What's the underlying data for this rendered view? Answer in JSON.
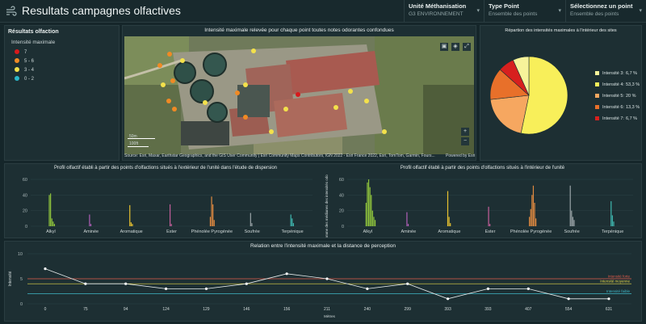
{
  "app": {
    "title": "Resultats campagnes olfactives",
    "icon": "wind-icon"
  },
  "header_selectors": [
    {
      "label": "Unité Méthanisation",
      "value": "G3 ENVIRONNEMENT"
    },
    {
      "label": "Type Point",
      "value": "Ensemble des points"
    },
    {
      "label": "Sélectionnez un point",
      "value": "Ensemble des points"
    }
  ],
  "legend": {
    "title": "Résultats olfaction",
    "subtitle": "Intensité maximale",
    "items": [
      {
        "label": "7",
        "color": "#d7191c"
      },
      {
        "label": "5 - 6",
        "color": "#f08a24"
      },
      {
        "label": "3 - 4",
        "color": "#f3e14b"
      },
      {
        "label": "0 - 2",
        "color": "#2ab7c9"
      }
    ]
  },
  "map": {
    "title": "Intensité maximale relevée pour chaque point toutes notes odorantes confondues",
    "scale_top": "50m",
    "scale_bottom": "100ft",
    "attribution": "Source: Esri, Maxar, Earthstar Geographics, and the GIS User Community | Esri Community Maps Contributors, IGN 2022 - Esri France 2022, Esri, TomTom, Garmin, Fours...",
    "powered_by": "Powered by Esri",
    "controls": [
      "bookmark-icon",
      "layers-icon",
      "expand-icon"
    ],
    "zoom_in": "+",
    "zoom_out": "−"
  },
  "chart_data": [
    {
      "type": "pie",
      "title": "Répartion des intensités maximales à l'intérieur des sites",
      "slices": [
        {
          "label": "Intensité 3:",
          "value": 6.7,
          "pct_text": "6,7 %",
          "color": "#f6f39a"
        },
        {
          "label": "Intensité 4:",
          "value": 53.3,
          "pct_text": "53,3 %",
          "color": "#f8ef5a"
        },
        {
          "label": "Intensité 5:",
          "value": 20,
          "pct_text": "20 %",
          "color": "#f6a760"
        },
        {
          "label": "Intensité 6:",
          "value": 13.3,
          "pct_text": "13,3 %",
          "color": "#e8702a"
        },
        {
          "label": "Intensité 7:",
          "value": 6.7,
          "pct_text": "6,7 %",
          "color": "#d7201e"
        }
      ]
    },
    {
      "type": "bar",
      "title": "Profil olfactif établi à partir des points d'olfactions situés à l'extérieur de l'unité dans l'étude de dispersion",
      "ylabel": "",
      "ylim": [
        0,
        60
      ],
      "yticks": [
        0,
        20,
        40,
        60
      ],
      "categories": [
        "Alkyl",
        "Aminée",
        "Aromatique",
        "Ester",
        "Phénolée Pyrogénée",
        "Soufrée",
        "Terpénique"
      ],
      "colors": [
        "#8fc43c",
        "#b05fb8",
        "#e8c230",
        "#c45f9a",
        "#e08a40",
        "#9aa4a8",
        "#3fb8b0"
      ],
      "values": [
        [
          40,
          42,
          10,
          6,
          3
        ],
        [
          15,
          3
        ],
        [
          27,
          5,
          3
        ],
        [
          28,
          3
        ],
        [
          12,
          38,
          28,
          8
        ],
        [
          17,
          4
        ],
        [
          15,
          10,
          4
        ]
      ]
    },
    {
      "type": "bar",
      "title": "Profil olfactif établi à partir des points d'olfactions situés à l'intérieur de l'unité",
      "ylabel": "Somme des médianes des intensités odorantes",
      "ylim": [
        0,
        60
      ],
      "yticks": [
        0,
        20,
        40,
        60
      ],
      "categories": [
        "Alkyl",
        "Aminée",
        "Aromatique",
        "Ester",
        "Phénolée Pyrogénée",
        "Soufrée",
        "Terpénique"
      ],
      "colors": [
        "#8fc43c",
        "#b05fb8",
        "#e8c230",
        "#c45f9a",
        "#e08a40",
        "#9aa4a8",
        "#3fb8b0"
      ],
      "values": [
        [
          30,
          56,
          60,
          50,
          40,
          20,
          12,
          8
        ],
        [
          18,
          3
        ],
        [
          45,
          12,
          4
        ],
        [
          25,
          3
        ],
        [
          12,
          22,
          40,
          52,
          30,
          10
        ],
        [
          52,
          20,
          12,
          8
        ],
        [
          32,
          14,
          6
        ]
      ]
    },
    {
      "type": "line",
      "title": "Relation entre l'intensité maximale et la distance de perception",
      "xlabel": "Mètres",
      "ylabel": "Intensité",
      "ylim": [
        0,
        10
      ],
      "yticks": [
        0,
        5,
        10
      ],
      "x": [
        "0",
        "75",
        "94",
        "124",
        "129",
        "146",
        "156",
        "211",
        "240",
        "299",
        "393",
        "393",
        "407",
        "554",
        "631"
      ],
      "y": [
        7,
        4,
        4,
        3,
        3,
        4,
        6,
        5,
        3,
        4,
        1,
        3,
        3,
        1,
        1
      ],
      "thresholds": [
        {
          "label": "Intensité forte",
          "value": 5,
          "color": "#e05a4a"
        },
        {
          "label": "Intensité moyenne",
          "value": 4,
          "color": "#e8d84a"
        },
        {
          "label": "Intensité faible",
          "value": 2,
          "color": "#3fb8c8"
        }
      ]
    }
  ]
}
